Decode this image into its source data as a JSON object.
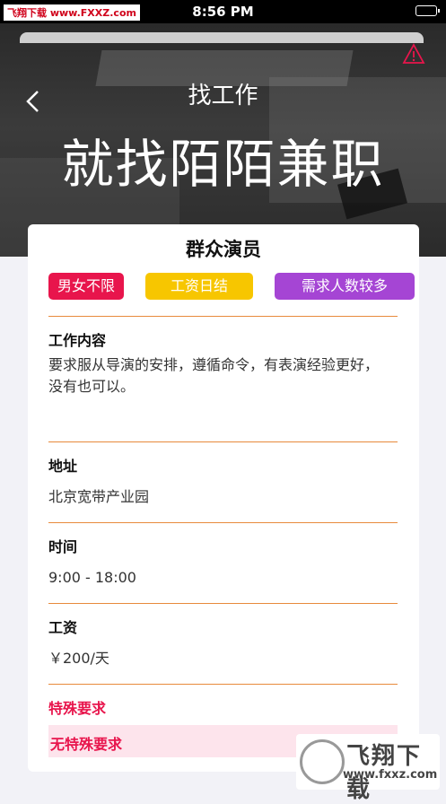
{
  "status_bar": {
    "time": "8:56 PM",
    "watermark": "飞翔下载 www.FXXZ.com"
  },
  "header": {
    "title": "找工作",
    "slogan": "就找陌陌兼职",
    "back_icon": "chevron-left-icon",
    "warning_icon": "warning-triangle-icon"
  },
  "job": {
    "title": "群众演员",
    "tags": [
      "男女不限",
      "工资日结",
      "需求人数较多"
    ],
    "sections": [
      {
        "label": "工作内容",
        "value": "要求服从导演的安排，遵循命令，有表演经验更好，没有也可以。"
      },
      {
        "label": "地址",
        "value": "北京宽带产业园"
      },
      {
        "label": "时间",
        "value": "9:00 - 18:00"
      },
      {
        "label": "工资",
        "value": "￥200/天"
      }
    ],
    "special": {
      "label": "特殊要求",
      "value": "无特殊要求"
    }
  },
  "watermark_logo": {
    "name": "飞翔下载",
    "url": "www.fxxz.com"
  },
  "colors": {
    "pink": "#e8154c",
    "yellow": "#f7c600",
    "purple": "#a545d4",
    "divider": "#e88a3c"
  }
}
